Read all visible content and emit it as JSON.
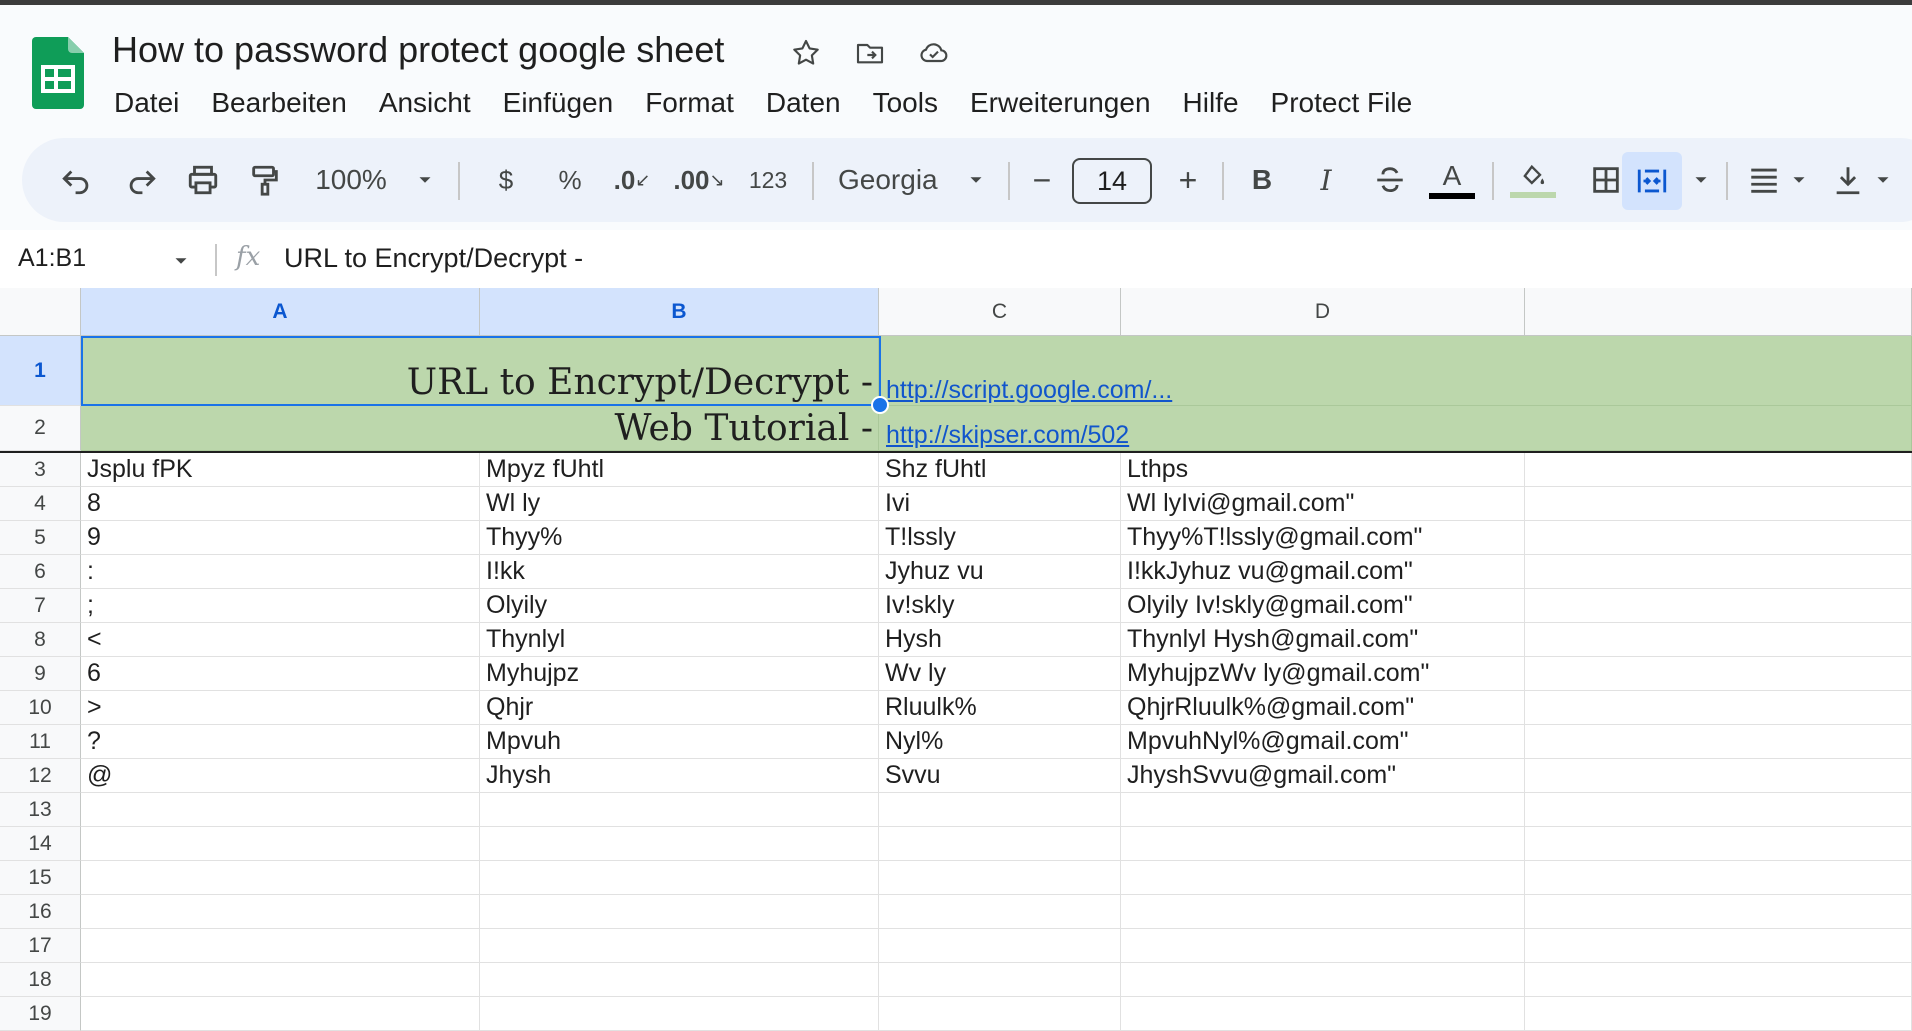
{
  "app": {
    "title": "How to password protect google sheet",
    "menu": [
      "Datei",
      "Bearbeiten",
      "Ansicht",
      "Einfügen",
      "Format",
      "Daten",
      "Tools",
      "Erweiterungen",
      "Hilfe",
      "Protect File"
    ]
  },
  "toolbar": {
    "zoom": "100%",
    "currency": "$",
    "percent": "%",
    "decrease_decimal": ".0",
    "increase_decimal": ".00",
    "number_format": "123",
    "font": "Georgia",
    "font_size": "14",
    "minus": "−",
    "plus": "+",
    "bold": "B",
    "italic": "I",
    "text_color_letter": "A"
  },
  "formula_bar": {
    "name_box": "A1:B1",
    "fx": "fx",
    "value": "URL to Encrypt/Decrypt -"
  },
  "sheet": {
    "columns": [
      "A",
      "B",
      "C",
      "D"
    ],
    "row_numbers": [
      "1",
      "2",
      "3",
      "4",
      "5",
      "6",
      "7",
      "8",
      "9",
      "10",
      "11",
      "12",
      "13",
      "14",
      "15",
      "16",
      "17",
      "18",
      "19"
    ],
    "merged_rows": [
      {
        "label": "URL to Encrypt/Decrypt -",
        "link": "http://script.google.com/..."
      },
      {
        "label": "Web Tutorial -",
        "link": "http://skipser.com/502"
      }
    ],
    "rows": [
      [
        "Jsplu fPK",
        "Mpyz fUhtl",
        "Shz fUhtl",
        "Lthps"
      ],
      [
        "8",
        "Wl ly",
        "Ivi",
        "Wl lyIvi@gmail.com\""
      ],
      [
        "9",
        "Thyy%",
        "T!lssly",
        "Thyy%T!lssly@gmail.com\""
      ],
      [
        ":",
        "I!kk",
        "Jyhuz vu",
        "I!kkJyhuz vu@gmail.com\""
      ],
      [
        ";",
        "Olyily",
        "Iv!skly",
        "Olyily Iv!skly@gmail.com\""
      ],
      [
        "<",
        "Thynlyl",
        "Hysh",
        "Thynlyl Hysh@gmail.com\""
      ],
      [
        "6",
        "Myhujpz",
        "Wv  ly",
        "MyhujpzWv  ly@gmail.com\""
      ],
      [
        ">",
        "Qhjr",
        "Rluulk%",
        "QhjrRluulk%@gmail.com\""
      ],
      [
        "?",
        "Mpvuh",
        "Nyl%",
        "MpvuhNyl%@gmail.com\""
      ],
      [
        "@",
        "Jhysh",
        "Svvu",
        "JhyshSvvu@gmail.com\""
      ]
    ]
  },
  "colors": {
    "header_fill": "#bcd7ac",
    "selection": "#1a73e8",
    "link": "#1155cc",
    "sheets_green": "#0f9d58"
  }
}
